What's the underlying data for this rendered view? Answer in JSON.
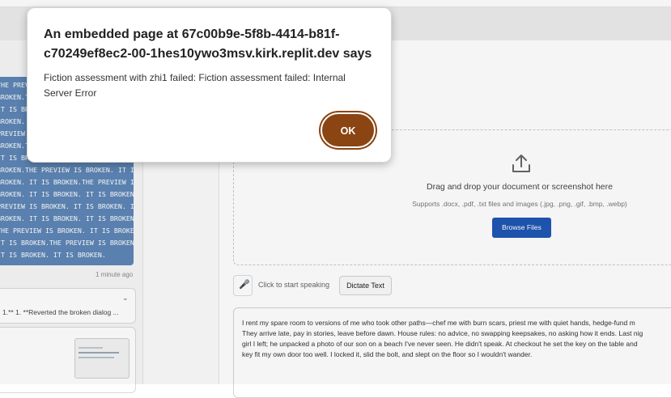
{
  "dialog": {
    "title": "An embedded page at 67c00b9e-5f8b-4414-b81f-c70249ef8ec2-00-1hes10ywo3msv.kirk.replit.dev says",
    "message": "Fiction assessment with zhi1 failed: Fiction assessment failed: Internal Server Error",
    "ok_label": "OK"
  },
  "chat": {
    "bubble_lines": [
      "THE PREVIEW IS BROKEN. IT IS",
      "BROKEN.THE PREVIEW IS BROKEN.",
      "IT IS BROKEN.THE PREVIEW IS",
      "BROKEN. IT IS BROKEN.THE",
      "PREVIEW IS BROKEN. IT IS",
      "BROKEN.THE PREVIEW IS BROKEN.",
      "IT IS BROKEN.THE PREVIEW IS",
      "BROKEN.THE PREVIEW IS BROKEN. IT IS",
      "BROKEN. IT IS BROKEN.THE PREVIEW IS",
      "BROKEN. IT IS BROKEN. IT IS BROKEN.THE",
      "PREVIEW IS BROKEN. IT IS BROKEN. IT IS",
      "BROKEN. IT IS BROKEN. IT IS BROKEN.",
      "THE PREVIEW IS BROKEN. IT IS BROKEN.",
      "IT IS BROKEN.THE PREVIEW IS BROKEN.",
      "IT IS BROKEN. IT IS BROKEN."
    ],
    "timestamp": "1 minute ago",
    "card_text": "1.** 1. **Reverted the broken dialog ...",
    "card_chevron": "⌄"
  },
  "upload": {
    "title": "Drag and drop your document or screenshot here",
    "subtitle": "Supports .docx, .pdf, .txt files and images (.jpg, .png, .gif, .bmp, .webp)",
    "browse_label": "Browse Files"
  },
  "dictate": {
    "hint": "Click to start speaking",
    "button_label": "Dictate Text"
  },
  "textarea": {
    "lines": [
      "I rent my spare room to versions of me who took other paths—chef me with burn scars, priest me with quiet hands, hedge-fund m",
      "They arrive late, pay in stories, leave before dawn. House rules: no advice, no swapping keepsakes, no asking how it ends. Last nig",
      "girl I left; he unpacked a photo of our son on a beach I've never seen. He didn't speak. At checkout he set the key on the table and",
      "key fit my own door too well. I locked it, slid the bolt, and slept on the floor so I wouldn't wander."
    ]
  },
  "colors": {
    "ok_button": "#8b4513",
    "browse_button": "#1f57b4",
    "chat_bubble": "#5d86b6"
  }
}
